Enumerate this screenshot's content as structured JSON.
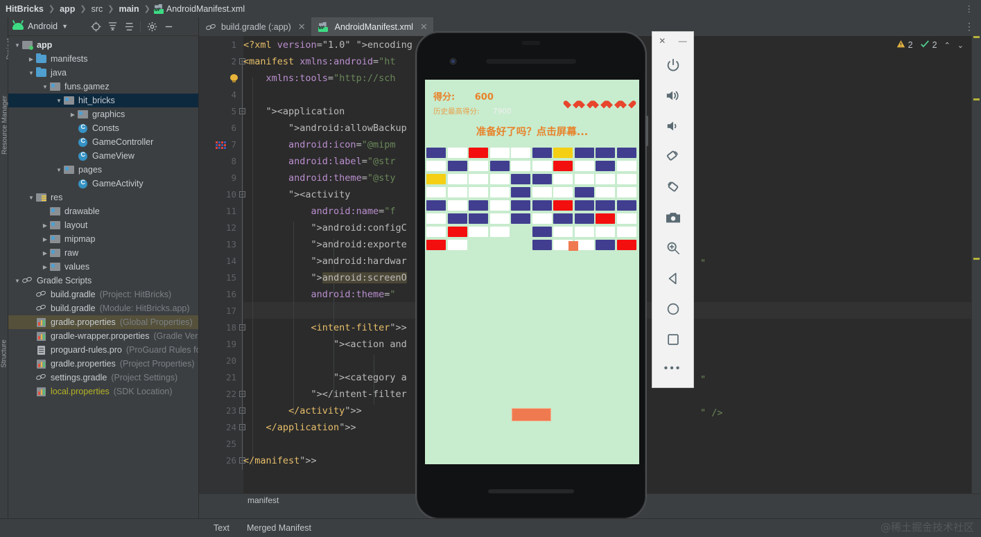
{
  "breadcrumb": {
    "items": [
      "HitBricks",
      "app",
      "src",
      "main"
    ],
    "file": "AndroidManifest.xml",
    "file_icon": "manifest-file-icon",
    "overflow_icon": "more-options-icon"
  },
  "project_panel": {
    "title": "Android",
    "icons": [
      "locate-icon",
      "expand-all-icon",
      "collapse-all-icon",
      "settings-gear-icon",
      "minimize-icon",
      "more-icon"
    ],
    "left_strips": [
      "Project",
      "Resource Manager",
      "Structure"
    ],
    "tree": [
      {
        "depth": 0,
        "arrow": "v",
        "icon": "module-folder-icon",
        "label": "app",
        "bold": true,
        "hint": "",
        "state": ""
      },
      {
        "depth": 1,
        "arrow": ">",
        "icon": "folder-icon",
        "label": "manifests",
        "bold": false,
        "hint": "",
        "state": ""
      },
      {
        "depth": 1,
        "arrow": "v",
        "icon": "folder-icon",
        "label": "java",
        "bold": false,
        "hint": "",
        "state": ""
      },
      {
        "depth": 2,
        "arrow": "v",
        "icon": "package-icon",
        "label": "funs.gamez",
        "bold": false,
        "hint": "",
        "state": ""
      },
      {
        "depth": 3,
        "arrow": "v",
        "icon": "package-icon",
        "label": "hit_bricks",
        "bold": false,
        "hint": "",
        "state": "sel"
      },
      {
        "depth": 4,
        "arrow": ">",
        "icon": "package-icon",
        "label": "graphics",
        "bold": false,
        "hint": "",
        "state": ""
      },
      {
        "depth": 4,
        "arrow": "",
        "icon": "class-icon",
        "label": "Consts",
        "bold": false,
        "hint": "",
        "state": ""
      },
      {
        "depth": 4,
        "arrow": "",
        "icon": "class-icon",
        "label": "GameController",
        "bold": false,
        "hint": "",
        "state": ""
      },
      {
        "depth": 4,
        "arrow": "",
        "icon": "class-icon",
        "label": "GameView",
        "bold": false,
        "hint": "",
        "state": ""
      },
      {
        "depth": 3,
        "arrow": "v",
        "icon": "package-icon",
        "label": "pages",
        "bold": false,
        "hint": "",
        "state": ""
      },
      {
        "depth": 4,
        "arrow": "",
        "icon": "class-icon",
        "label": "GameActivity",
        "bold": false,
        "hint": "",
        "state": ""
      },
      {
        "depth": 1,
        "arrow": "v",
        "icon": "res-folder-icon",
        "label": "res",
        "bold": false,
        "hint": "",
        "state": ""
      },
      {
        "depth": 2,
        "arrow": "",
        "icon": "package-icon",
        "label": "drawable",
        "bold": false,
        "hint": "",
        "state": ""
      },
      {
        "depth": 2,
        "arrow": ">",
        "icon": "package-icon",
        "label": "layout",
        "bold": false,
        "hint": "",
        "state": ""
      },
      {
        "depth": 2,
        "arrow": ">",
        "icon": "package-icon",
        "label": "mipmap",
        "bold": false,
        "hint": "",
        "state": ""
      },
      {
        "depth": 2,
        "arrow": ">",
        "icon": "package-icon",
        "label": "raw",
        "bold": false,
        "hint": "",
        "state": ""
      },
      {
        "depth": 2,
        "arrow": ">",
        "icon": "package-icon",
        "label": "values",
        "bold": false,
        "hint": "",
        "state": ""
      },
      {
        "depth": 0,
        "arrow": "v",
        "icon": "gradle-icon",
        "label": "Gradle Scripts",
        "bold": false,
        "hint": "",
        "state": ""
      },
      {
        "depth": 1,
        "arrow": "",
        "icon": "gradle-icon",
        "label": "build.gradle",
        "bold": false,
        "hint": "(Project: HitBricks)",
        "state": ""
      },
      {
        "depth": 1,
        "arrow": "",
        "icon": "gradle-icon",
        "label": "build.gradle",
        "bold": false,
        "hint": "(Module: HitBricks.app)",
        "state": ""
      },
      {
        "depth": 1,
        "arrow": "",
        "icon": "properties-icon",
        "label": "gradle.properties",
        "bold": false,
        "hint": "(Global Properties)",
        "state": "hl"
      },
      {
        "depth": 1,
        "arrow": "",
        "icon": "properties-icon",
        "label": "gradle-wrapper.properties",
        "bold": false,
        "hint": "(Gradle Version)",
        "state": ""
      },
      {
        "depth": 1,
        "arrow": "",
        "icon": "text-file-icon",
        "label": "proguard-rules.pro",
        "bold": false,
        "hint": "(ProGuard Rules for ",
        "state": ""
      },
      {
        "depth": 1,
        "arrow": "",
        "icon": "properties-icon",
        "label": "gradle.properties",
        "bold": false,
        "hint": "(Project Properties)",
        "state": ""
      },
      {
        "depth": 1,
        "arrow": "",
        "icon": "gradle-icon",
        "label": "settings.gradle",
        "bold": false,
        "hint": "(Project Settings)",
        "state": ""
      },
      {
        "depth": 1,
        "arrow": "",
        "icon": "properties-icon",
        "label": "local.properties",
        "bold": false,
        "hint": "(SDK Location)",
        "state": "yellow"
      }
    ]
  },
  "editor": {
    "tabs": [
      {
        "label": "build.gradle (:app)",
        "icon": "gradle-icon",
        "active": false
      },
      {
        "label": "AndroidManifest.xml",
        "icon": "manifest-file-icon",
        "active": true
      }
    ],
    "inspections": {
      "warning_count": "2",
      "check_count": "2"
    },
    "code_breadcrumb": "manifest",
    "lines": [
      {
        "n": "1",
        "text": "<?xml version=\"1.0\" encoding"
      },
      {
        "n": "2",
        "text": "<manifest xmlns:android=\"ht"
      },
      {
        "n": "3",
        "text": "    xmlns:tools=\"http://sch"
      },
      {
        "n": "4",
        "text": ""
      },
      {
        "n": "5",
        "text": "    <application"
      },
      {
        "n": "6",
        "text": "        android:allowBackup"
      },
      {
        "n": "7",
        "text": "        android:icon=\"@mipm"
      },
      {
        "n": "8",
        "text": "        android:label=\"@str"
      },
      {
        "n": "9",
        "text": "        android:theme=\"@sty"
      },
      {
        "n": "10",
        "text": "        <activity"
      },
      {
        "n": "11",
        "text": "            android:name=\"f"
      },
      {
        "n": "12",
        "text": "            android:configC"
      },
      {
        "n": "13",
        "text": "            android:exporte"
      },
      {
        "n": "14",
        "text": "            android:hardwar"
      },
      {
        "n": "15",
        "text": "            android:screenO"
      },
      {
        "n": "16",
        "text": "            android:theme=\""
      },
      {
        "n": "17",
        "text": ""
      },
      {
        "n": "18",
        "text": "            <intent-filter>"
      },
      {
        "n": "19",
        "text": "                <action and"
      },
      {
        "n": "20",
        "text": ""
      },
      {
        "n": "21",
        "text": "                <category a"
      },
      {
        "n": "22",
        "text": "            </intent-filter"
      },
      {
        "n": "23",
        "text": "        </activity>"
      },
      {
        "n": "24",
        "text": "    </application>"
      },
      {
        "n": "25",
        "text": ""
      },
      {
        "n": "26",
        "text": "</manifest>"
      }
    ],
    "floating_fragments": [
      "\"",
      "\"",
      "\" />"
    ]
  },
  "bottom_bar": {
    "left_label": "Text",
    "right_label": "Merged Manifest",
    "watermark": "@稀土掘金技术社区"
  },
  "emulator": {
    "close_icon": "close-icon",
    "minimize_icon": "minimize-icon",
    "buttons": [
      {
        "name": "power-icon"
      },
      {
        "name": "volume-up-icon"
      },
      {
        "name": "volume-down-icon"
      },
      {
        "name": "rotate-left-icon"
      },
      {
        "name": "rotate-right-icon"
      },
      {
        "name": "camera-icon"
      },
      {
        "name": "zoom-in-icon"
      },
      {
        "name": "back-icon"
      },
      {
        "name": "home-icon"
      },
      {
        "name": "overview-icon"
      },
      {
        "name": "more-icon"
      }
    ]
  },
  "game": {
    "score_label": "得分:",
    "score_value": "600",
    "high_label": "历史最高得分:",
    "high_value": "7900",
    "prompt": "准备好了吗？点击屏幕...",
    "lives": 5,
    "colors": {
      "background": "#c8ecce",
      "brick_blue": "#413e8f",
      "brick_red": "#f40f0f",
      "brick_yellow": "#f5cf14",
      "brick_white": "#ffffff",
      "ball": "#ef7a4f",
      "paddle": "#ef7a4f",
      "score_text": "#e8832b",
      "heart": "#e8452c"
    },
    "grid": [
      [
        "blue",
        "white",
        "red",
        "white",
        "white",
        "blue",
        "yellow",
        "blue",
        "blue",
        "blue"
      ],
      [
        "white",
        "blue",
        "white",
        "blue",
        "white",
        "white",
        "red",
        "white",
        "blue",
        "white"
      ],
      [
        "yellow",
        "white",
        "white",
        "white",
        "blue",
        "blue",
        "white",
        "white",
        "white",
        "white"
      ],
      [
        "white",
        "white",
        "white",
        "white",
        "blue",
        "white",
        "white",
        "blue",
        "white",
        "white"
      ],
      [
        "blue",
        "white",
        "blue",
        "white",
        "blue",
        "blue",
        "red",
        "blue",
        "blue",
        "blue"
      ],
      [
        "white",
        "blue",
        "blue",
        "white",
        "blue",
        "white",
        "blue",
        "blue",
        "red",
        "white"
      ],
      [
        "white",
        "red",
        "white",
        "white",
        "none",
        "blue",
        "white",
        "white",
        "white",
        "white"
      ],
      [
        "red",
        "white",
        "none",
        "none",
        "none",
        "blue",
        "white",
        "white",
        "blue",
        "red"
      ]
    ]
  }
}
